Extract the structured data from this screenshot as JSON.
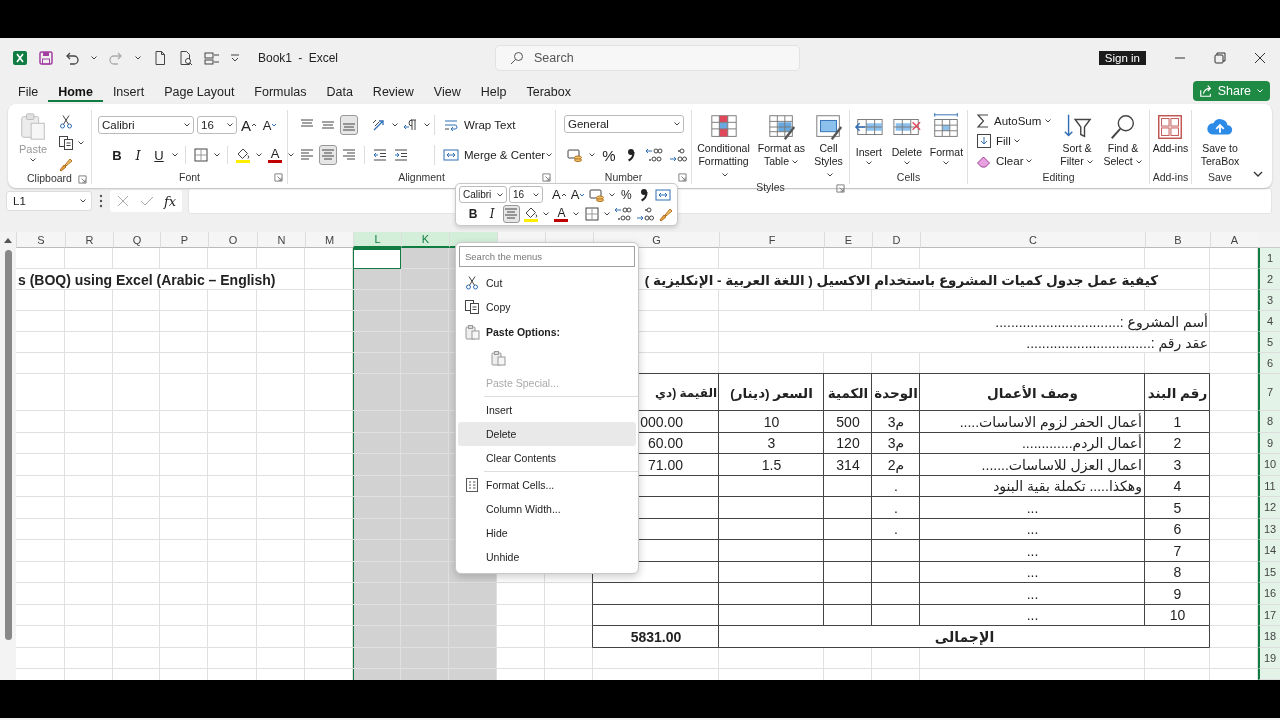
{
  "window": {
    "title": "Book1 - Excel",
    "search_placeholder": "Search",
    "sign_in": "Sign in"
  },
  "tabs": [
    {
      "label": "File",
      "selected": false
    },
    {
      "label": "Home",
      "selected": true
    },
    {
      "label": "Insert",
      "selected": false
    },
    {
      "label": "Page Layout",
      "selected": false
    },
    {
      "label": "Formulas",
      "selected": false
    },
    {
      "label": "Data",
      "selected": false
    },
    {
      "label": "Review",
      "selected": false
    },
    {
      "label": "View",
      "selected": false
    },
    {
      "label": "Help",
      "selected": false
    },
    {
      "label": "Terabox",
      "selected": false
    }
  ],
  "share": "Share",
  "ribbon": {
    "groups": [
      {
        "kind": "clipboard",
        "label": "Clipboard",
        "launcher": true,
        "paste": {
          "label": "Paste",
          "disabled": true
        }
      },
      {
        "kind": "font",
        "label": "Font",
        "launcher": true,
        "font": "Calibri",
        "size": "16",
        "row1": [
          {
            "kind": "grow",
            "label": "A",
            "selected": false
          },
          {
            "kind": "shrink",
            "label": "A",
            "selected": false
          }
        ],
        "row2": [
          {
            "kind": "bold",
            "label": "B",
            "selected": false
          },
          {
            "kind": "italic",
            "label": "I",
            "selected": false
          },
          {
            "kind": "underline",
            "label": "U",
            "selected": false
          },
          {
            "kind": "borders",
            "selected": false
          },
          {
            "kind": "fill",
            "selected": false
          },
          {
            "kind": "font-color",
            "label": "A",
            "selected": false
          }
        ]
      },
      {
        "kind": "alignment",
        "label": "Alignment",
        "launcher": true,
        "row1": [
          {
            "kind": "align-top",
            "selected": false
          },
          {
            "kind": "align-middle",
            "selected": false
          },
          {
            "kind": "align-bottom",
            "selected": true
          },
          {
            "kind": "orientation",
            "selected": false
          },
          {
            "kind": "text-direction",
            "selected": false
          }
        ],
        "row1_button": "Wrap Text",
        "row2": [
          {
            "kind": "align-left",
            "selected": false
          },
          {
            "kind": "align-center",
            "selected": true
          },
          {
            "kind": "align-right",
            "selected": false
          },
          {
            "kind": "indent-decrease",
            "selected": false
          },
          {
            "kind": "indent-increase",
            "selected": false
          }
        ],
        "row2_button": "Merge & Center"
      },
      {
        "kind": "number",
        "label": "Number",
        "launcher": true,
        "format": "General",
        "row2": [
          {
            "kind": "accounting",
            "selected": false
          },
          {
            "kind": "percent",
            "label": "%",
            "selected": false
          },
          {
            "kind": "comma",
            "selected": false
          },
          {
            "kind": "decimal-increase",
            "selected": false
          },
          {
            "kind": "decimal-decrease",
            "selected": false
          }
        ]
      },
      {
        "kind": "styles",
        "label": "Styles",
        "launcher": true,
        "buttons": [
          {
            "kind": "conditional-formatting",
            "label": "Conditional Formatting"
          },
          {
            "kind": "format-as-table",
            "label": "Format as Table"
          },
          {
            "kind": "cell-styles",
            "label": "Cell Styles"
          }
        ]
      },
      {
        "kind": "cells",
        "label": "Cells",
        "launcher": false,
        "buttons": [
          {
            "kind": "insert",
            "label": "Insert"
          },
          {
            "kind": "delete",
            "label": "Delete"
          },
          {
            "kind": "format",
            "label": "Format"
          }
        ]
      },
      {
        "kind": "editing",
        "label": "Editing",
        "launcher": false,
        "small": [
          {
            "kind": "autosum",
            "label": "AutoSum"
          },
          {
            "kind": "fill",
            "label": "Fill"
          },
          {
            "kind": "clear",
            "label": "Clear"
          }
        ],
        "buttons": [
          {
            "kind": "sort-filter",
            "label": "Sort & Filter"
          },
          {
            "kind": "find-select",
            "label": "Find & Select"
          }
        ]
      },
      {
        "kind": "addins",
        "label": "Add-ins",
        "launcher": false,
        "buttons": [
          {
            "kind": "add-ins",
            "label": "Add-ins"
          }
        ]
      },
      {
        "kind": "save",
        "label": "Save",
        "launcher": false,
        "buttons": [
          {
            "kind": "save-cloud",
            "label": "Save to TeraBox"
          }
        ]
      }
    ]
  },
  "formula_bar": {
    "name_box": "L1",
    "function_label": "fx"
  },
  "sheet": {
    "column_headers": [
      {
        "label": "S",
        "selected": false
      },
      {
        "label": "R",
        "selected": false
      },
      {
        "label": "Q",
        "selected": false
      },
      {
        "label": "P",
        "selected": false
      },
      {
        "label": "O",
        "selected": false
      },
      {
        "label": "N",
        "selected": false
      },
      {
        "label": "M",
        "selected": false
      },
      {
        "label": "L",
        "selected": true
      },
      {
        "label": "K",
        "selected": true
      },
      {
        "selected": true
      },
      {
        "selected": false
      },
      {
        "selected": false
      },
      {
        "label": "G",
        "selected": false
      },
      {
        "label": "F",
        "selected": false
      },
      {
        "label": "E",
        "selected": false
      },
      {
        "label": "D",
        "selected": false
      },
      {
        "label": "C",
        "selected": false
      },
      {
        "label": "B",
        "selected": false
      },
      {
        "label": "A",
        "selected": false
      }
    ],
    "row_headers": [
      "1",
      "2",
      "3",
      "4",
      "5",
      "6",
      "7",
      "8",
      "9",
      "10",
      "11",
      "12",
      "13",
      "14",
      "15",
      "16",
      "17",
      "18",
      "19"
    ],
    "overflow_text": "s (BOQ) using Excel (Arabic – English)",
    "title": "كيفية عمل جدول كميات المشروع باستخدام الاكسيل ( اللغة العربية - الإنكليزية )",
    "project_name": "أسم المشروع :................................",
    "contract_no": "عقد رقم :................................",
    "boq_table": {
      "columns": [
        "القيمة (دي",
        "السعر (دينار)",
        "الكمية",
        "الوحدة",
        "وصف الأعمال",
        "رقم البند"
      ],
      "rows": [
        {
          "kind": "item",
          "cells": [
            "000.00",
            "10",
            "500",
            "م3",
            "أعمال الحفر لزوم الاساسات.....",
            "1"
          ]
        },
        {
          "kind": "item",
          "cells": [
            "60.00",
            "3",
            "120",
            "م3",
            "أعمال الردم.............",
            "2"
          ]
        },
        {
          "kind": "item",
          "cells": [
            "71.00",
            "1.5",
            "314",
            "م2",
            "اعمال العزل للاساسات.......",
            "3"
          ]
        },
        {
          "kind": "item",
          "cells": [
            "",
            "",
            "",
            ".",
            "وهكذا..... تكملة بقية البنود",
            "4"
          ]
        },
        {
          "kind": "placeholder",
          "cells": [
            "",
            "",
            "",
            ".",
            "...",
            "5"
          ]
        },
        {
          "kind": "placeholder",
          "cells": [
            "",
            "",
            "",
            ".",
            "...",
            "6"
          ]
        },
        {
          "kind": "placeholder",
          "cells": [
            "",
            "",
            "",
            "",
            "...",
            "7"
          ]
        },
        {
          "kind": "placeholder",
          "cells": [
            "",
            "",
            "",
            "",
            "...",
            "8"
          ]
        },
        {
          "kind": "placeholder",
          "cells": [
            "",
            "",
            "",
            "",
            "...",
            "9"
          ]
        },
        {
          "kind": "placeholder",
          "cells": [
            "",
            "",
            "",
            "",
            "...",
            "10"
          ]
        }
      ],
      "total_value": "5831.00",
      "total_label": "الإجمالى"
    }
  },
  "mini_toolbar": {
    "font": "Calibri",
    "size": "16",
    "row1": [
      {
        "kind": "grow",
        "label": "A",
        "selected": false
      },
      {
        "kind": "shrink",
        "label": "A",
        "selected": false
      },
      {
        "kind": "accounting",
        "selected": false
      },
      {
        "kind": "percent",
        "label": "%",
        "selected": false
      },
      {
        "kind": "comma",
        "selected": false
      },
      {
        "kind": "merge",
        "selected": false
      }
    ],
    "row2": [
      {
        "kind": "bold",
        "label": "B",
        "selected": false
      },
      {
        "kind": "italic",
        "label": "I",
        "selected": false
      },
      {
        "kind": "align-center",
        "selected": true
      },
      {
        "kind": "fill",
        "selected": false
      },
      {
        "kind": "font-color",
        "label": "A",
        "selected": false
      },
      {
        "kind": "borders",
        "selected": false
      },
      {
        "kind": "decimal-increase",
        "selected": false
      },
      {
        "kind": "decimal-decrease",
        "selected": false
      },
      {
        "kind": "painter",
        "selected": false
      }
    ]
  },
  "context_menu": {
    "search_placeholder": "Search the menus",
    "items": [
      {
        "kind": "cut",
        "label": "Cut",
        "disabled": false,
        "highlighted": false
      },
      {
        "kind": "copy",
        "label": "Copy",
        "disabled": false,
        "highlighted": false
      },
      {
        "kind": "paste-header",
        "label": "Paste Options:",
        "disabled": false,
        "highlighted": false
      },
      {
        "kind": "paste-buttons",
        "disabled": false,
        "highlighted": false
      },
      {
        "kind": "command",
        "label": "Paste Special...",
        "disabled": true,
        "highlighted": false
      },
      {
        "kind": "separator"
      },
      {
        "kind": "command",
        "label": "Insert",
        "disabled": false,
        "highlighted": false
      },
      {
        "kind": "command",
        "label": "Delete",
        "disabled": false,
        "highlighted": true
      },
      {
        "kind": "command",
        "label": "Clear Contents",
        "disabled": false,
        "highlighted": false
      },
      {
        "kind": "separator"
      },
      {
        "kind": "format-cells",
        "label": "Format Cells...",
        "disabled": false,
        "highlighted": false
      },
      {
        "kind": "command",
        "label": "Column Width...",
        "disabled": false,
        "highlighted": false
      },
      {
        "kind": "command",
        "label": "Hide",
        "disabled": false,
        "highlighted": false
      },
      {
        "kind": "command",
        "label": "Unhide",
        "disabled": false,
        "highlighted": false
      }
    ]
  }
}
